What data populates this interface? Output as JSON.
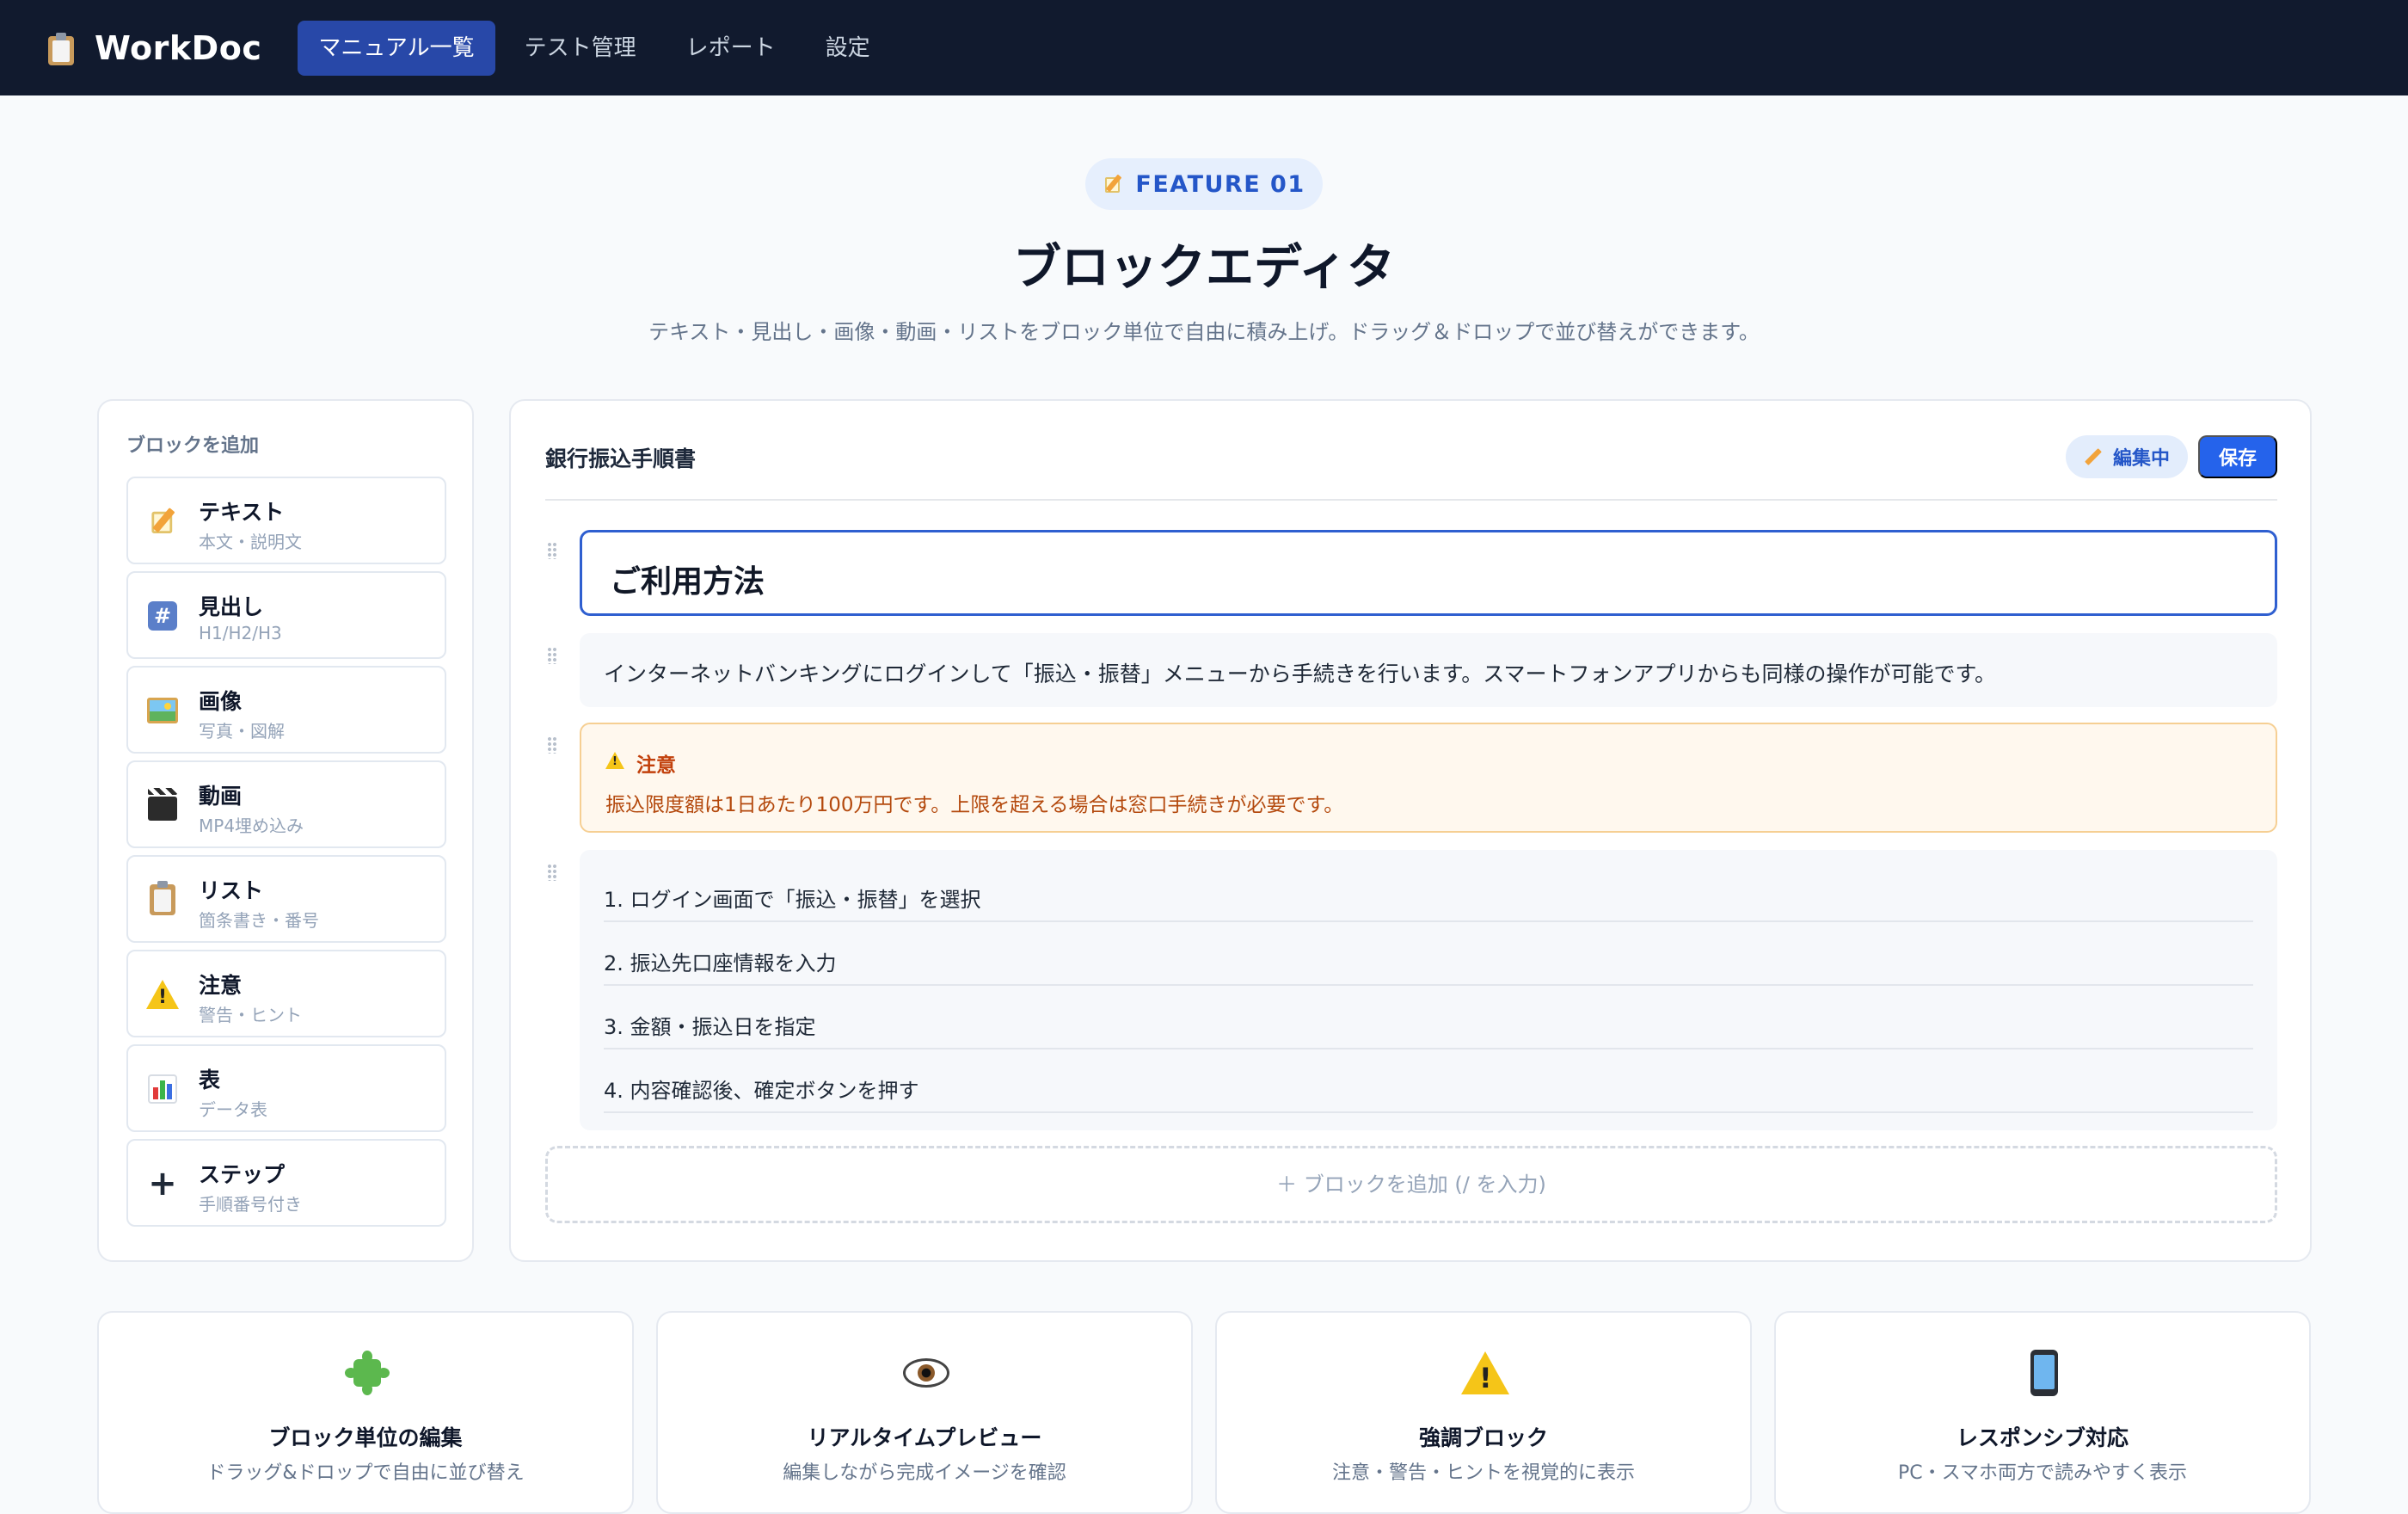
{
  "app": {
    "name": "WorkDoc",
    "logo_icon": "clipboard-icon"
  },
  "nav": {
    "items": [
      {
        "label": "マニュアル一覧",
        "active": true
      },
      {
        "label": "テスト管理",
        "active": false
      },
      {
        "label": "レポート",
        "active": false
      },
      {
        "label": "設定",
        "active": false
      }
    ]
  },
  "hero": {
    "badge_icon": "memo-icon",
    "badge": "FEATURE 01",
    "title": "ブロックエディタ",
    "subtitle": "テキスト・見出し・画像・動画・リストをブロック単位で自由に積み上げ。ドラッグ＆ドロップで並び替えができます。"
  },
  "palette": {
    "title": "ブロックを追加",
    "items": [
      {
        "icon": "memo-icon",
        "name": "テキスト",
        "desc": "本文・説明文"
      },
      {
        "icon": "hash-icon",
        "name": "見出し",
        "desc": "H1/H2/H3"
      },
      {
        "icon": "image-icon",
        "name": "画像",
        "desc": "写真・図解"
      },
      {
        "icon": "clapper-icon",
        "name": "動画",
        "desc": "MP4埋め込み"
      },
      {
        "icon": "clipboard-icon",
        "name": "リスト",
        "desc": "箇条書き・番号"
      },
      {
        "icon": "warning-icon",
        "name": "注意",
        "desc": "警告・ヒント"
      },
      {
        "icon": "bar-chart-icon",
        "name": "表",
        "desc": "データ表"
      },
      {
        "icon": "plus-icon",
        "name": "ステップ",
        "desc": "手順番号付き"
      }
    ]
  },
  "editor": {
    "doc_title": "銀行振込手順書",
    "status_label": "編集中",
    "status_icon": "pencil-icon",
    "save_label": "保存",
    "heading_block": "ご利用方法",
    "text_block": "インターネットバンキングにログインして「振込・振替」メニューから手続きを行います。スマートフォンアプリからも同様の操作が可能です。",
    "warning_block": {
      "icon": "warning-icon",
      "title": "注意",
      "body": "振込限度額は1日あたり100万円です。上限を超える場合は窓口手続きが必要です。"
    },
    "list_block": [
      "1. ログイン画面で「振込・振替」を選択",
      "2. 振込先口座情報を入力",
      "3. 金額・振込日を指定",
      "4. 内容確認後、確定ボタンを押す"
    ],
    "add_block_label": "＋ ブロックを追加 (/ を入力)"
  },
  "features": [
    {
      "icon": "puzzle-icon",
      "title": "ブロック単位の編集",
      "desc": "ドラッグ&ドロップで自由に並び替え"
    },
    {
      "icon": "eye-icon",
      "title": "リアルタイムプレビュー",
      "desc": "編集しながら完成イメージを確認"
    },
    {
      "icon": "warning-icon",
      "title": "強調ブロック",
      "desc": "注意・警告・ヒントを視覚的に表示"
    },
    {
      "icon": "phone-icon",
      "title": "レスポンシブ対応",
      "desc": "PC・スマホ両方で読みやすく表示"
    }
  ],
  "colors": {
    "nav_bg": "#111a2e",
    "accent": "#2563eb",
    "warning_bg": "#fff8ee",
    "warning_text": "#c2410c"
  }
}
